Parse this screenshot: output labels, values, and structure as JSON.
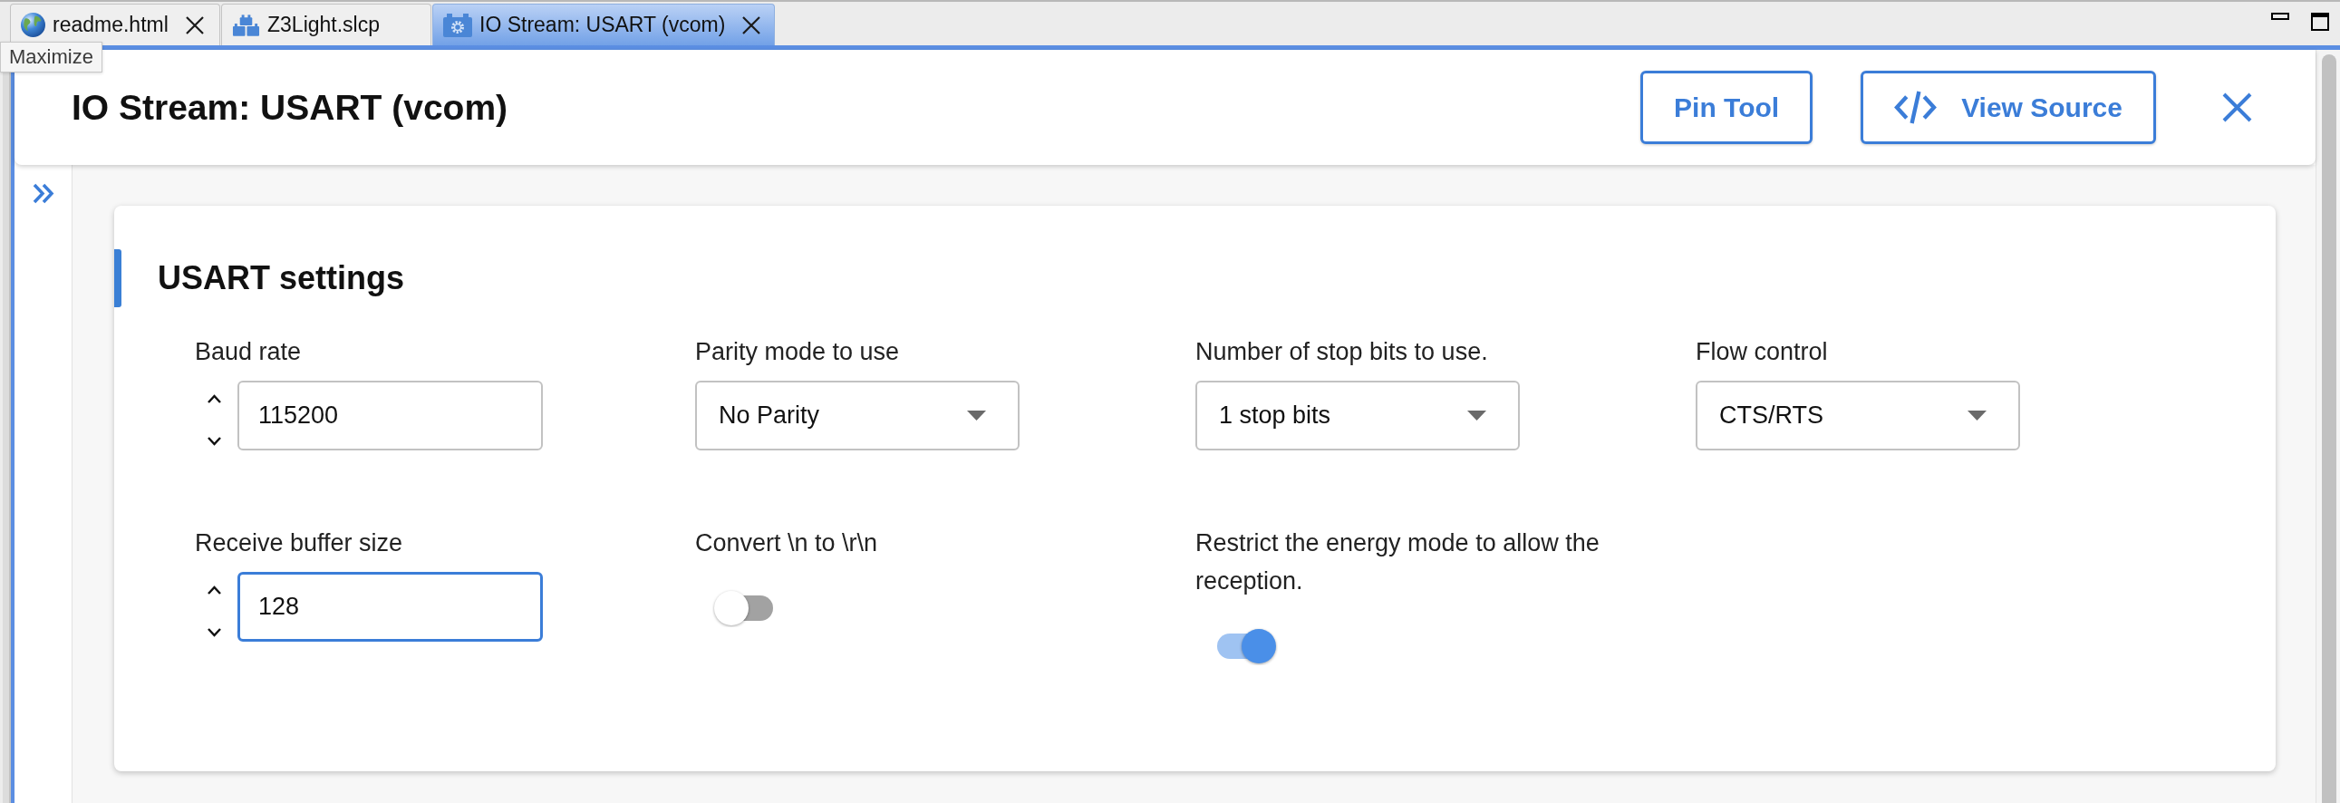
{
  "tabs": [
    {
      "label": "readme.html",
      "kind": "web",
      "closable": true,
      "selected": false
    },
    {
      "label": "Z3Light.slcp",
      "kind": "project",
      "closable": false,
      "selected": false
    },
    {
      "label": "IO Stream: USART (vcom)",
      "kind": "config",
      "closable": true,
      "selected": true
    }
  ],
  "tooltip": {
    "text": "Maximize"
  },
  "header": {
    "title": "IO Stream: USART (vcom)",
    "buttons": [
      {
        "label": "Pin Tool",
        "kind": "text"
      },
      {
        "label": "View Source",
        "kind": "code"
      }
    ]
  },
  "settings": {
    "title": "USART settings",
    "fields": [
      {
        "label": "Baud rate",
        "kind": "number",
        "value": "115200",
        "focused": false
      },
      {
        "label": "Parity mode to use",
        "kind": "select",
        "value": "No Parity",
        "focused": false
      },
      {
        "label": "Number of stop bits to use.",
        "kind": "select",
        "value": "1 stop bits",
        "focused": false
      },
      {
        "label": "Flow control",
        "kind": "select",
        "value": "CTS/RTS",
        "focused": false
      },
      {
        "label": "Receive buffer size",
        "kind": "number",
        "value": "128",
        "focused": true
      },
      {
        "label": "Convert \\n to \\r\\n",
        "kind": "switch",
        "on": false
      },
      {
        "label": "Restrict the energy mode to allow the reception.",
        "kind": "switch",
        "on": true
      }
    ]
  }
}
